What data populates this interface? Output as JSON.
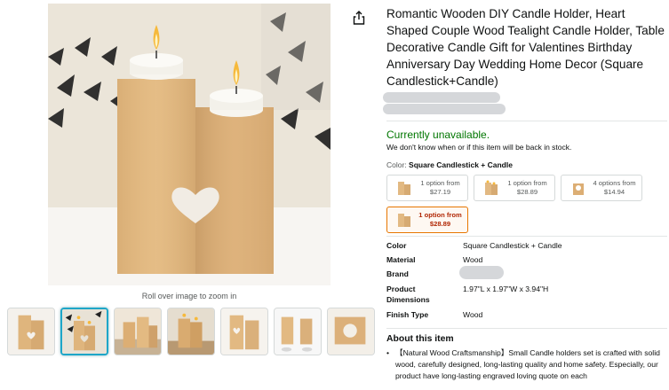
{
  "product": {
    "title": "Romantic Wooden DIY Candle Holder, Heart Shaped Couple Wood Tealight Candle Holder, Table Decorative Candle Gift for Valentines Birthday Anniversary Day Wedding Home Decor (Square Candlestick+Candle)"
  },
  "gallery": {
    "zoom_hint": "Roll over image to zoom in",
    "thumbnails": [
      "thumb-1",
      "thumb-2",
      "thumb-3",
      "thumb-4",
      "thumb-5",
      "thumb-6",
      "thumb-7"
    ],
    "active_index": 1
  },
  "availability": {
    "status": "Currently unavailable.",
    "note": "We don't know when or if this item will be back in stock."
  },
  "color": {
    "label": "Color: ",
    "selected": "Square Candlestick + Candle"
  },
  "variants": [
    {
      "line1": "1 option from",
      "price": "$27.19"
    },
    {
      "line1": "1 option from",
      "price": "$28.89"
    },
    {
      "line1": "4 options from",
      "price": "$14.94"
    },
    {
      "line1": "1 option from",
      "price": "$28.89"
    }
  ],
  "specs": {
    "color_label": "Color",
    "color_value": "Square Candlestick + Candle",
    "material_label": "Material",
    "material_value": "Wood",
    "brand_label": "Brand",
    "dimensions_label_1": "Product",
    "dimensions_label_2": "Dimensions",
    "dimensions_value": "1.97\"L x 1.97\"W x 3.94\"H",
    "finish_label": "Finish Type",
    "finish_value": "Wood"
  },
  "about": {
    "heading": "About this item",
    "bullet_1": "【Natural Wood Craftsmanship】Small Candle holders set is crafted with solid wood, carefully designed, long-lasting quality and home safety. Especially, our product have long-lasting engraved loving quote on each"
  },
  "colors": {
    "link_teal": "#007185",
    "in_stock_green": "#007600",
    "selected_border": "#e77600",
    "price_red": "#b12704",
    "wood": "#e0b77e"
  },
  "icons": {
    "share": "share-icon"
  }
}
